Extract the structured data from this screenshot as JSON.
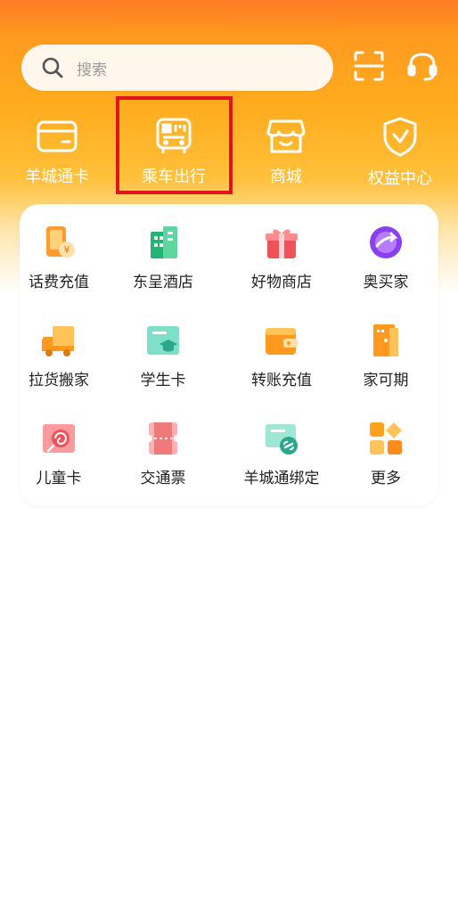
{
  "search": {
    "placeholder": "搜索"
  },
  "header_actions": {
    "scan_icon": "scan-icon",
    "service_icon": "headset-icon"
  },
  "quick_nav": [
    {
      "label": "羊城通卡",
      "icon": "card-icon"
    },
    {
      "label": "乘车出行",
      "icon": "bus-qr-icon"
    },
    {
      "label": "商城",
      "icon": "store-icon"
    },
    {
      "label": "权益中心",
      "icon": "shield-check-icon"
    }
  ],
  "services": [
    {
      "label": "话费充值",
      "icon": "phone-recharge-icon",
      "color": "#ff8a1e"
    },
    {
      "label": "东呈酒店",
      "icon": "hotel-icon",
      "color": "#22b573"
    },
    {
      "label": "好物商店",
      "icon": "gift-icon",
      "color": "#f0525a"
    },
    {
      "label": "奥买家",
      "icon": "aomaijia-logo-icon",
      "color": "#8a3ff0"
    },
    {
      "label": "拉货搬家",
      "icon": "truck-icon",
      "color": "#ffa21e"
    },
    {
      "label": "学生卡",
      "icon": "student-card-icon",
      "color": "#3cc4a6"
    },
    {
      "label": "转账充值",
      "icon": "wallet-icon",
      "color": "#ffa21e"
    },
    {
      "label": "家可期",
      "icon": "door-icon",
      "color": "#ff8a1e"
    },
    {
      "label": "儿童卡",
      "icon": "lollipop-icon",
      "color": "#f0525a"
    },
    {
      "label": "交通票",
      "icon": "ticket-icon",
      "color": "#f07a7a"
    },
    {
      "label": "羊城通绑定",
      "icon": "link-card-icon",
      "color": "#3cc4a6"
    },
    {
      "label": "更多",
      "icon": "more-grid-icon",
      "color": "#ffa21e"
    }
  ]
}
